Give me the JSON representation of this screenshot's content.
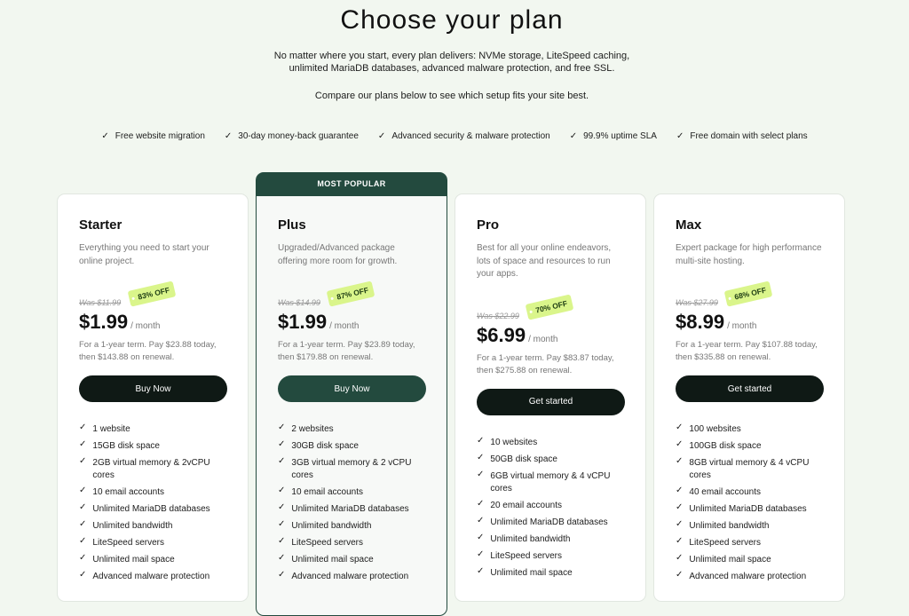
{
  "header": {
    "title": "Choose your plan",
    "intro_line1": "No matter where you start, every plan delivers: NVMe storage, LiteSpeed caching,",
    "intro_line2": "unlimited MariaDB databases, advanced malware protection, and free SSL.",
    "compare": "Compare our plans below to see which setup fits your site best."
  },
  "features": [
    "Free website migration",
    "30-day money-back guarantee",
    "Advanced security & malware protection",
    "99.9% uptime SLA",
    "Free domain with select plans"
  ],
  "check_icon": "✓",
  "plans": [
    {
      "name": "Starter",
      "description": "Everything you need to start your online project.",
      "was": "Was $11.99",
      "off": "83% OFF",
      "price": "$1.99",
      "per": "/ month",
      "term_line1": "For a 1-year term. Pay $23.88 today,",
      "term_line2": "then $143.88 on renewal.",
      "cta": "Buy Now",
      "features": [
        "1 website",
        "15GB disk space",
        "2GB virtual memory & 2vCPU cores",
        "10 email accounts",
        "Unlimited MariaDB databases",
        "Unlimited bandwidth",
        "LiteSpeed servers",
        "Unlimited mail space",
        "Advanced malware protection"
      ]
    },
    {
      "name": "Plus",
      "badge": "MOST POPULAR",
      "description": "Upgraded/Advanced package offering more room for growth.",
      "was": "Was $14.99",
      "off": "87% OFF",
      "price": "$1.99",
      "per": "/ month",
      "term_line1": "For a 1-year term. Pay $23.89 today,",
      "term_line2": "then $179.88 on renewal.",
      "cta": "Buy Now",
      "features": [
        "2 websites",
        "30GB disk space",
        "3GB virtual memory & 2 vCPU cores",
        "10 email accounts",
        "Unlimited MariaDB databases",
        "Unlimited bandwidth",
        "LiteSpeed servers",
        "Unlimited mail space",
        "Advanced malware protection"
      ]
    },
    {
      "name": "Pro",
      "description": "Best for all your online endeavors, lots of space and resources to run your apps.",
      "was": "Was $22.99",
      "off": "70% OFF",
      "price": "$6.99",
      "per": "/ month",
      "term_line1": "For a 1-year term. Pay $83.87 today,",
      "term_line2": "then $275.88 on renewal.",
      "cta": "Get started",
      "features": [
        "10 websites",
        "50GB disk space",
        "6GB virtual memory & 4 vCPU cores",
        "20 email accounts",
        "Unlimited MariaDB databases",
        "Unlimited bandwidth",
        "LiteSpeed servers",
        "Unlimited mail space"
      ]
    },
    {
      "name": "Max",
      "description": "Expert package for high performance multi-site hosting.",
      "was": "Was $27.99",
      "off": "68% OFF",
      "price": "$8.99",
      "per": "/ month",
      "term_line1": "For a 1-year term. Pay $107.88 today,",
      "term_line2": "then $335.88 on renewal.",
      "cta": "Get started",
      "features": [
        "100 websites",
        "100GB disk space",
        "8GB virtual memory & 4 vCPU cores",
        "40 email accounts",
        "Unlimited MariaDB databases",
        "Unlimited bandwidth",
        "LiteSpeed servers",
        "Unlimited mail space",
        "Advanced malware protection"
      ]
    }
  ],
  "colors": {
    "background": "#f2f7f0",
    "brand_dark": "#0f1915",
    "popular_green": "#234a3e",
    "off_tag": "#daf58b"
  }
}
